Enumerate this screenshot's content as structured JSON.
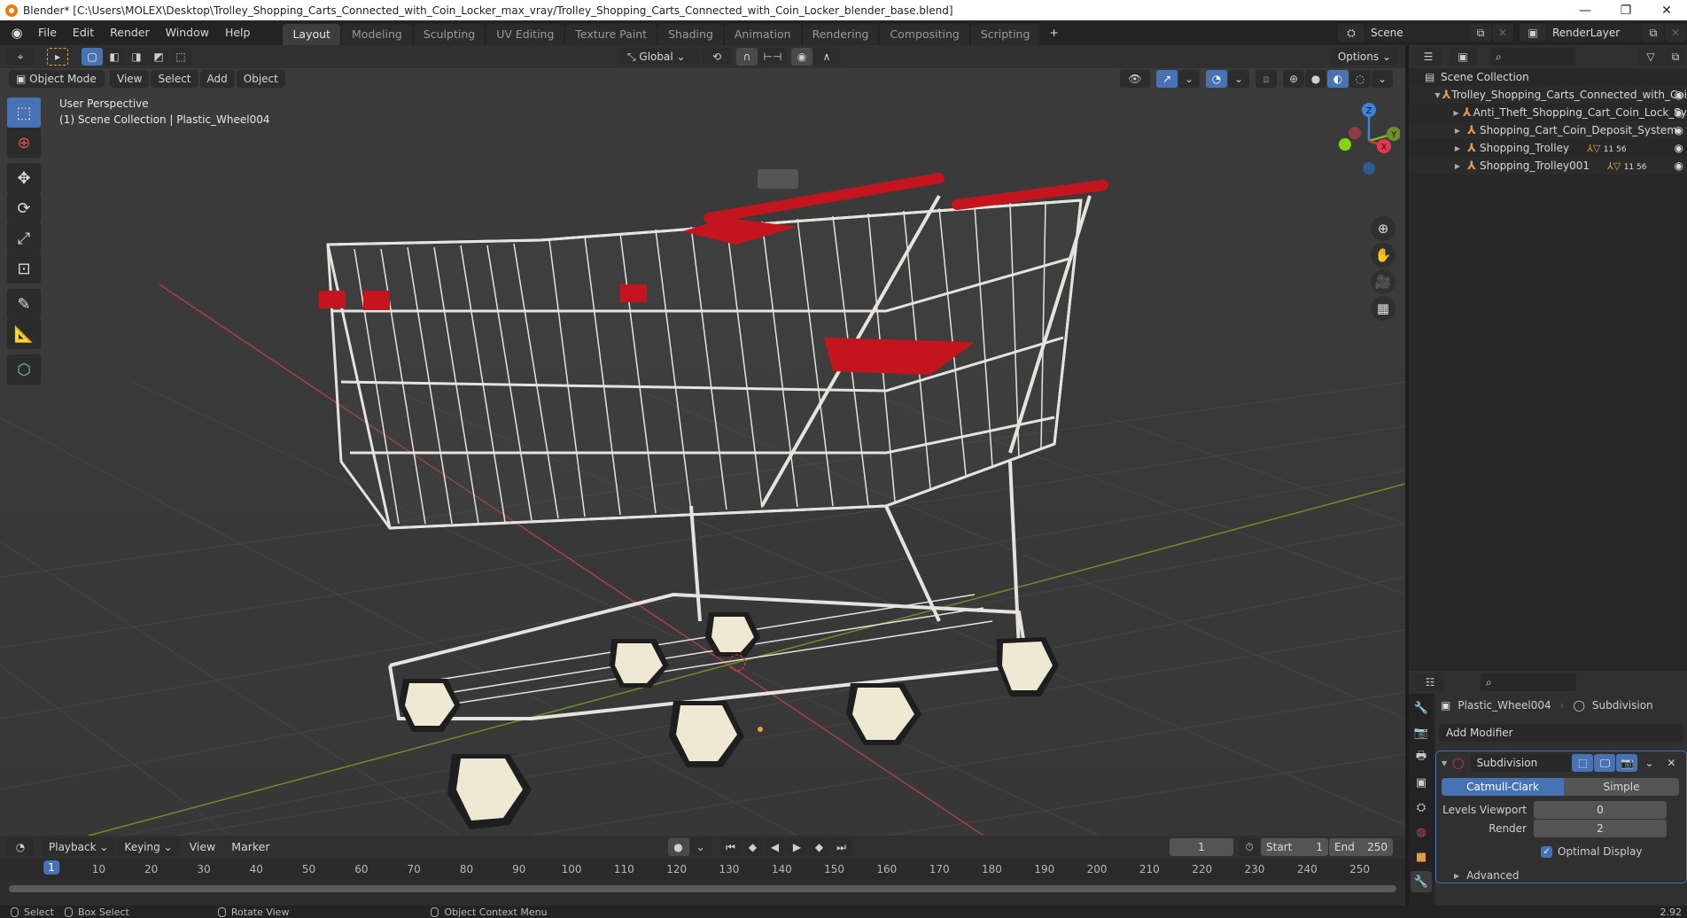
{
  "window": {
    "title": "Blender* [C:\\Users\\MOLEX\\Desktop\\Trolley_Shopping_Carts_Connected_with_Coin_Locker_max_vray/Trolley_Shopping_Carts_Connected_with_Coin_Locker_blender_base.blend]",
    "controls": {
      "minimize": "—",
      "maximize": "❐",
      "close": "✕"
    }
  },
  "menubar": {
    "items": [
      "File",
      "Edit",
      "Render",
      "Window",
      "Help"
    ],
    "workspaces": [
      "Layout",
      "Modeling",
      "Sculpting",
      "UV Editing",
      "Texture Paint",
      "Shading",
      "Animation",
      "Rendering",
      "Compositing",
      "Scripting"
    ],
    "active_workspace": "Layout",
    "add_workspace": "+",
    "scene": "Scene",
    "view_layer": "RenderLayer"
  },
  "viewport": {
    "mode": "Object Mode",
    "menus": [
      "View",
      "Select",
      "Add",
      "Object"
    ],
    "orientation": "Global",
    "options_label": "Options",
    "overlay_line1": "User Perspective",
    "overlay_line2": "(1) Scene Collection | Plastic_Wheel004",
    "gizmo_axes": {
      "x": "X",
      "y": "Y",
      "z": "Z"
    },
    "axis_colors": {
      "x": "#d9364a",
      "y": "#7db31f",
      "z": "#3a84e0"
    },
    "cart_colors": {
      "frame": "#e6e3df",
      "handle": "#c4141e",
      "wheel": "#efe8d2",
      "tire": "#1e1e1e"
    }
  },
  "outliner": {
    "root": "Scene Collection",
    "items": [
      {
        "name": "Trolley_Shopping_Carts_Connected_with_Coi",
        "level": 0,
        "expanded": true,
        "badges": ""
      },
      {
        "name": "Anti_Theft_Shopping_Cart_Coin_Lock_Sy",
        "level": 1,
        "expanded": false,
        "badges": ""
      },
      {
        "name": "Shopping_Cart_Coin_Deposit_System",
        "level": 1,
        "expanded": false,
        "badges": ""
      },
      {
        "name": "Shopping_Trolley",
        "level": 1,
        "expanded": false,
        "badges": "11 56"
      },
      {
        "name": "Shopping_Trolley001",
        "level": 1,
        "expanded": false,
        "badges": "11 56"
      }
    ]
  },
  "properties": {
    "object": "Plastic_Wheel004",
    "modifier_context": "Subdivision",
    "add_modifier": "Add Modifier",
    "modifier": {
      "name": "Subdivision",
      "types": [
        "Catmull-Clark",
        "Simple"
      ],
      "active_type": "Catmull-Clark",
      "levels_viewport_label": "Levels Viewport",
      "levels_viewport": "0",
      "render_label": "Render",
      "render": "2",
      "optimal_display_label": "Optimal Display",
      "optimal_display": true,
      "advanced_label": "Advanced"
    }
  },
  "timeline": {
    "menus": [
      "Playback",
      "Keying",
      "View",
      "Marker"
    ],
    "current_frame": "1",
    "start_label": "Start",
    "start": "1",
    "end_label": "End",
    "end": "250",
    "ticks": [
      "10",
      "20",
      "30",
      "40",
      "50",
      "60",
      "70",
      "80",
      "90",
      "100",
      "110",
      "120",
      "130",
      "140",
      "150",
      "160",
      "170",
      "180",
      "190",
      "200",
      "210",
      "220",
      "230",
      "240",
      "250"
    ]
  },
  "statusbar": {
    "hints": [
      "Select",
      "Box Select",
      "Rotate View",
      "Object Context Menu"
    ],
    "version": "2.92"
  }
}
